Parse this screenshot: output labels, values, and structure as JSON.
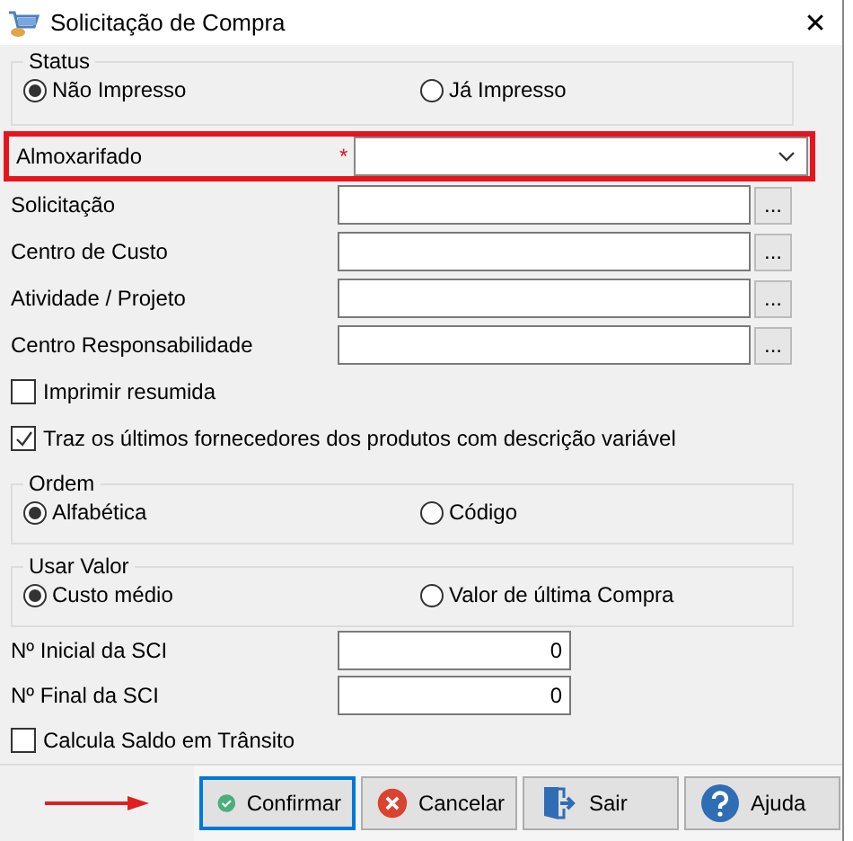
{
  "window": {
    "title": "Solicitação de Compra",
    "close": "✕"
  },
  "status": {
    "legend": "Status",
    "options": [
      {
        "label": "Não Impresso",
        "selected": true
      },
      {
        "label": "Já Impresso",
        "selected": false
      }
    ]
  },
  "almoxarifado": {
    "label": "Almoxarifado",
    "required": "*",
    "highlighted": true
  },
  "lookups": [
    {
      "label": "Solicitação",
      "button": "..."
    },
    {
      "label": "Centro de Custo",
      "button": "..."
    },
    {
      "label": "Atividade / Projeto",
      "button": "..."
    },
    {
      "label": "Centro Responsabilidade",
      "button": "..."
    }
  ],
  "checks_top": [
    {
      "label": "Imprimir resumida",
      "checked": false
    },
    {
      "label": "Traz os últimos fornecedores dos produtos com descrição variável",
      "checked": true
    }
  ],
  "ordem": {
    "legend": "Ordem",
    "options": [
      {
        "label": "Alfabética",
        "selected": true
      },
      {
        "label": "Código",
        "selected": false
      }
    ]
  },
  "usar_valor": {
    "legend": "Usar Valor",
    "options": [
      {
        "label": "Custo médio",
        "selected": true
      },
      {
        "label": "Valor de última Compra",
        "selected": false
      }
    ]
  },
  "numbers": [
    {
      "label": "Nº Inicial da SCI",
      "value": "0"
    },
    {
      "label": "Nº Final da SCI",
      "value": "0"
    }
  ],
  "checks_bottom": [
    {
      "label": "Calcula Saldo em Trânsito",
      "checked": false
    }
  ],
  "footer": {
    "pointer_arrow": true,
    "buttons": [
      {
        "kind": "confirm",
        "label": "Confirmar",
        "focused": true
      },
      {
        "kind": "cancel",
        "label": "Cancelar",
        "focused": false
      },
      {
        "kind": "exit",
        "label": "Sair",
        "focused": false
      },
      {
        "kind": "help",
        "label": "Ajuda",
        "focused": false
      }
    ]
  }
}
